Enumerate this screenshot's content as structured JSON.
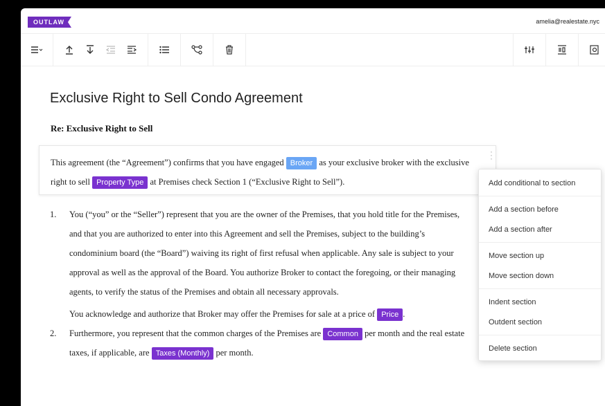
{
  "app": {
    "logo": "OUTLAW",
    "user_email": "amelia@realestate.nyc"
  },
  "toolbar": {
    "icons": [
      "align-menu-icon",
      "move-up-icon",
      "move-down-icon",
      "outdent-icon",
      "indent-icon",
      "list-icon",
      "branch-icon",
      "delete-icon",
      "settings-sliders-icon",
      "numbering-icon",
      "preview-icon"
    ]
  },
  "document": {
    "title": "Exclusive Right to Sell Condo Agreement",
    "re_line": "Re: Exclusive Right to Sell",
    "section": {
      "t1": "This agreement (the “Agreement”) confirms that you have engaged",
      "tag_broker": "Broker",
      "t2": "as your exclusive broker with the exclusive right to sell",
      "tag_property": "Property Type",
      "t3": "at Premises check Section 1 (“Exclusive Right to Sell”)."
    },
    "items": [
      {
        "num": "1.",
        "text": "You (“you” or the “Seller”) represent that you are the owner of the Premises, that you hold title for the Premises, and that you are authorized to enter into this Agreement and sell the Premises, subject to the building’s condominium board (the “Board”) waiving its right of first refusal when applicable. Any sale is subject to your approval as well as the approval of the Board. You authorize Broker to contact the foregoing, or their managing agents, to verify the status of the Premises and obtain all necessary approvals.",
        "p2_a": "You acknowledge and authorize that Broker may offer the Premises for sale at a price of",
        "tag_price": "Price",
        "p2_b": "."
      },
      {
        "num": "2.",
        "t1": "Furthermore, you represent that the common charges of the Premises are",
        "tag_common": "Common",
        "t2": "per month and the real estate taxes, if applicable, are",
        "tag_taxes": "Taxes (Monthly)",
        "t3": "per month."
      }
    ]
  },
  "context_menu": {
    "add_conditional": "Add conditional to section",
    "add_before": "Add a section before",
    "add_after": "Add a section after",
    "move_up": "Move section up",
    "move_down": "Move section down",
    "indent": "Indent section",
    "outdent": "Outdent section",
    "delete": "Delete section"
  },
  "colors": {
    "brand": "#6f2dbd",
    "tag_purple": "#7a32cf",
    "tag_blue": "#6aa6f5"
  }
}
